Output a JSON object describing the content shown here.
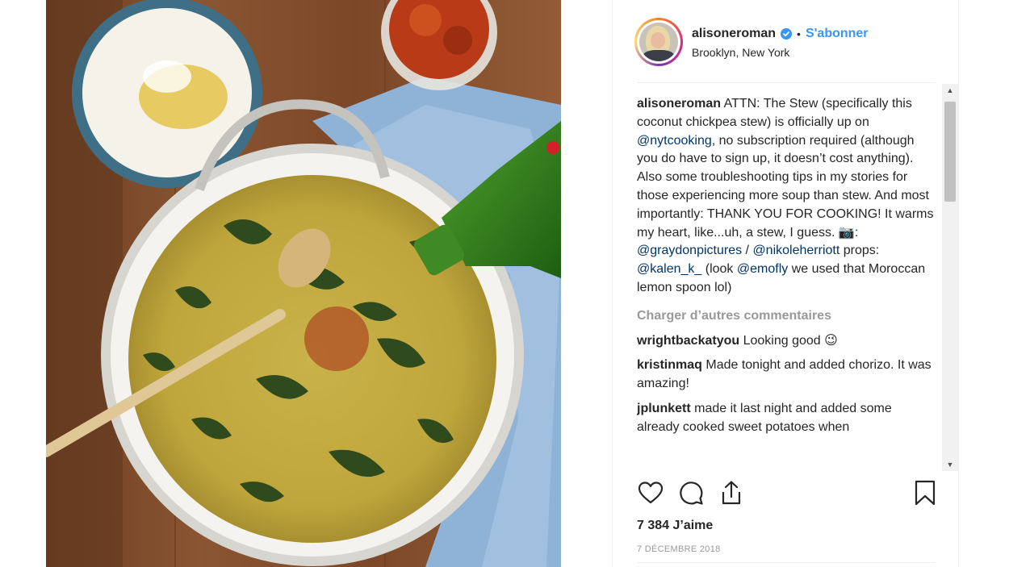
{
  "post": {
    "username": "alisoneroman",
    "follow_label": "S'abonner",
    "separator": "•",
    "location": "Brooklyn, New York",
    "verified_icon": "verified-badge-icon"
  },
  "caption": {
    "username": "alisoneroman",
    "part1": " ATTN: The Stew (specifically this coconut chickpea stew) is officially up on ",
    "mention1": "@nytcooking",
    "part2": ", no subscription required (although you do have to sign up, it doesn’t cost anything). Also some troubleshooting tips in my stories for those experiencing more soup than stew. And most importantly: THANK YOU FOR COOKING! It warms my heart, like...uh, a stew, I guess. 📷: ",
    "mention2": "@graydonpictures",
    "part3": " / ",
    "mention3": "@nikoleherriott",
    "part4": " props: ",
    "mention4": "@kalen_k_",
    "part5": " (look ",
    "mention5": "@emofly",
    "part6": " we used that Moroccan lemon spoon lol)"
  },
  "load_more_label": "Charger d’autres commentaires",
  "comments": [
    {
      "username": "wrightbackatyou",
      "text": " Looking good 😉"
    },
    {
      "username": "kristinmaq",
      "text": " Made tonight and added chorizo. It was amazing!"
    },
    {
      "username": "jplunkett",
      "text": " made it last night and added some already cooked sweet potatoes when"
    }
  ],
  "actions": {
    "like_icon": "heart-icon",
    "comment_icon": "comment-icon",
    "share_icon": "share-icon",
    "save_icon": "bookmark-icon"
  },
  "likes": "7 384 J’aime",
  "date": "7 DÉCEMBRE 2018",
  "colors": {
    "link": "#3897f0",
    "mention": "#003569",
    "muted": "#999999",
    "text": "#262626"
  }
}
